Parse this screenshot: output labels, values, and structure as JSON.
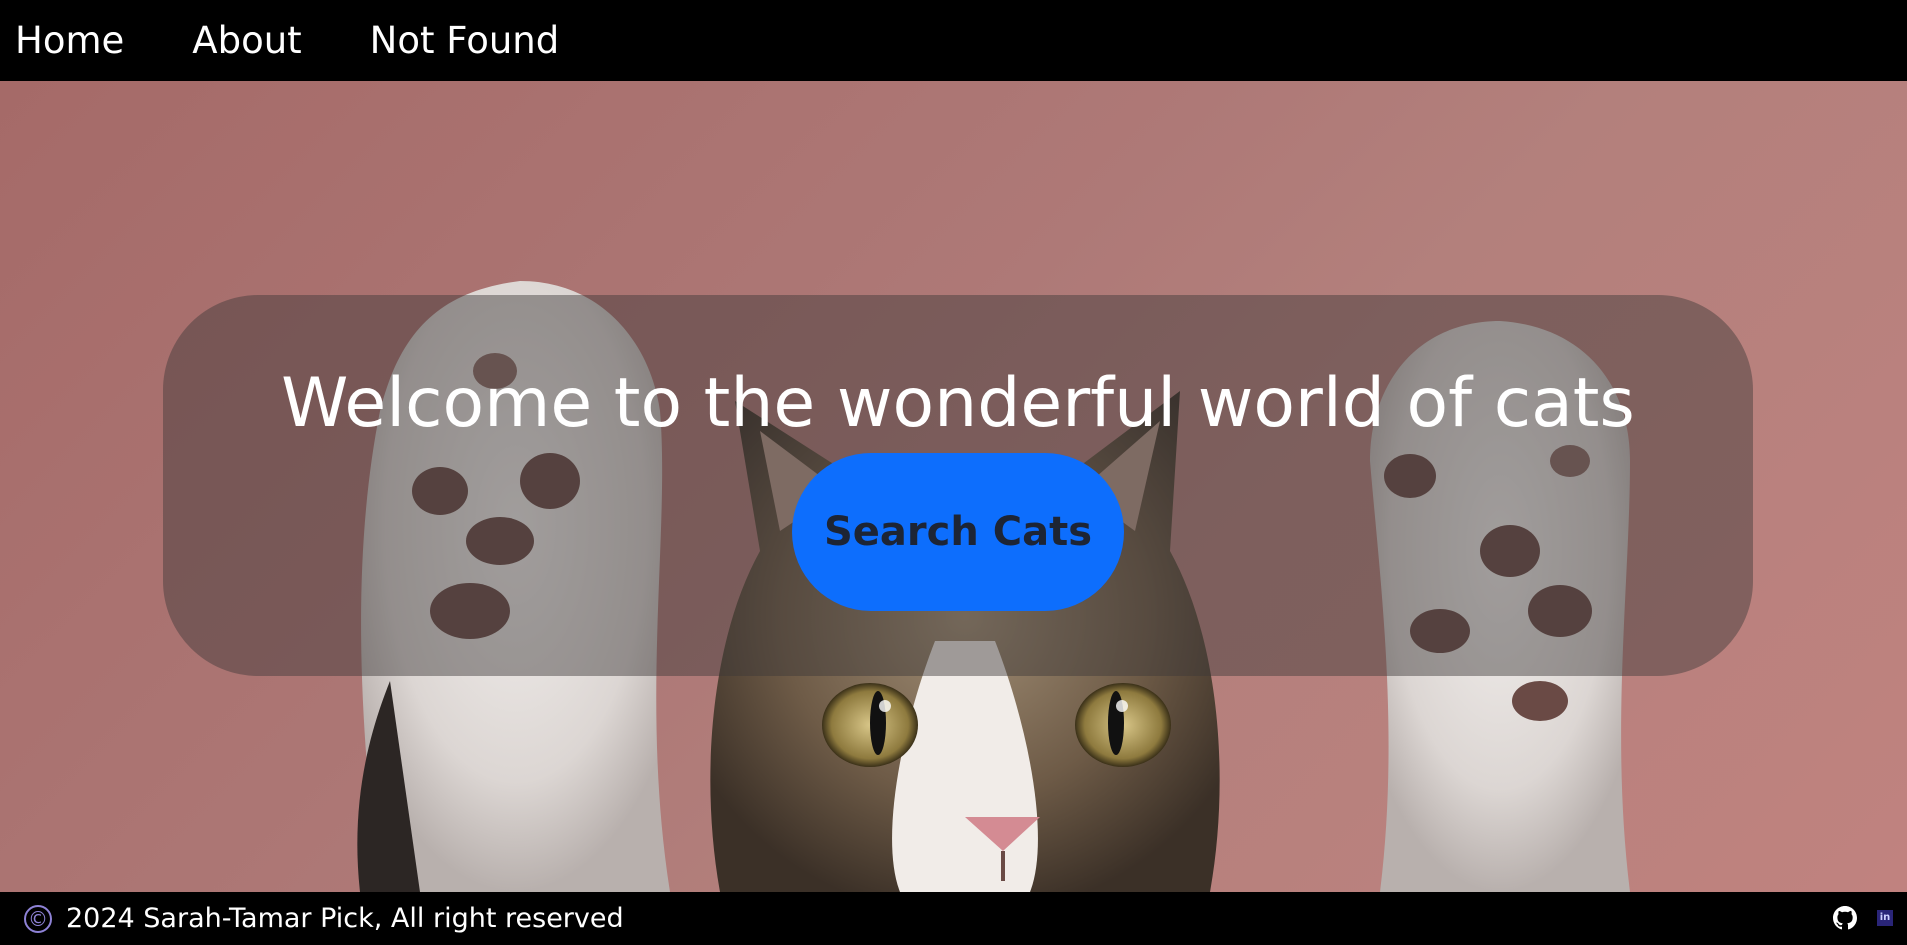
{
  "nav": {
    "items": [
      {
        "label": "Home"
      },
      {
        "label": "About"
      },
      {
        "label": "Not Found"
      }
    ]
  },
  "hero": {
    "title": "Welcome to the wonderful world of cats",
    "button_label": "Search Cats",
    "image": "cat-raising-paws-photo"
  },
  "footer": {
    "copyright_symbol": "©",
    "text": "2024 Sarah-Tamar Pick, All right reserved",
    "icons": [
      "github-icon",
      "linkedin-icon"
    ],
    "linkedin_label": "in"
  },
  "colors": {
    "nav_bg": "#000000",
    "footer_bg": "#000000",
    "button_bg": "#0d6efd",
    "button_text": "#1d2535",
    "hero_bg": "#ae7977",
    "copyright_icon": "#8e82d6"
  }
}
